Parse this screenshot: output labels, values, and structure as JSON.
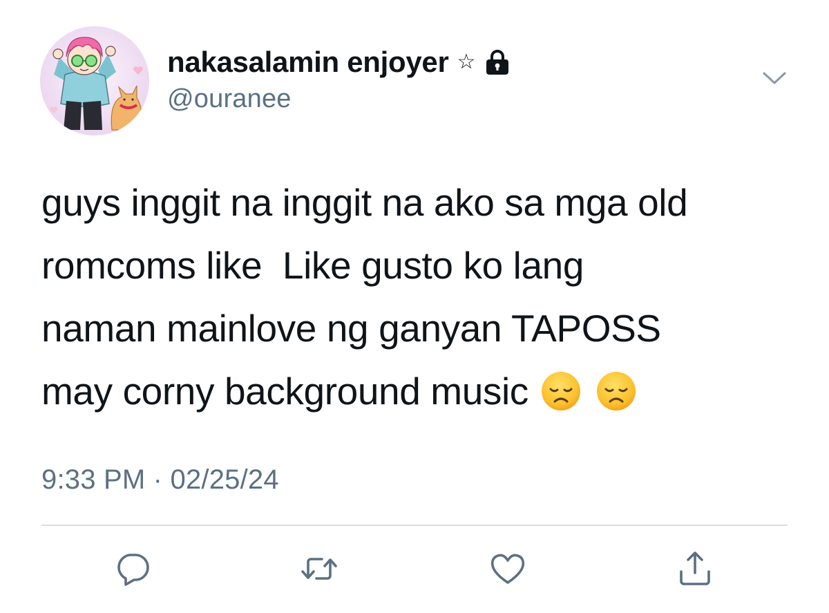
{
  "tweet": {
    "display_name": "nakasalamin enjoyer",
    "name_symbol": "☆",
    "handle": "@ouranee",
    "text_lines": [
      "guys inggit na inggit na ako sa mga old",
      "romcoms like  Like gusto ko lang",
      "naman mainlove ng ganyan TAPOSS",
      "may corny background music"
    ],
    "emojis": [
      "disappointed-face",
      "disappointed-face"
    ],
    "timestamp": "9:33 PM · 02/25/24"
  },
  "icons": {
    "protected": "lock-icon",
    "more": "chevron-down-icon",
    "reply": "reply-icon",
    "retweet": "retweet-icon",
    "like": "heart-icon",
    "share": "share-icon"
  },
  "colors": {
    "text": "#0f1419",
    "secondary": "#5b7083",
    "divider": "#d9dee2",
    "icon": "#5b7083"
  }
}
